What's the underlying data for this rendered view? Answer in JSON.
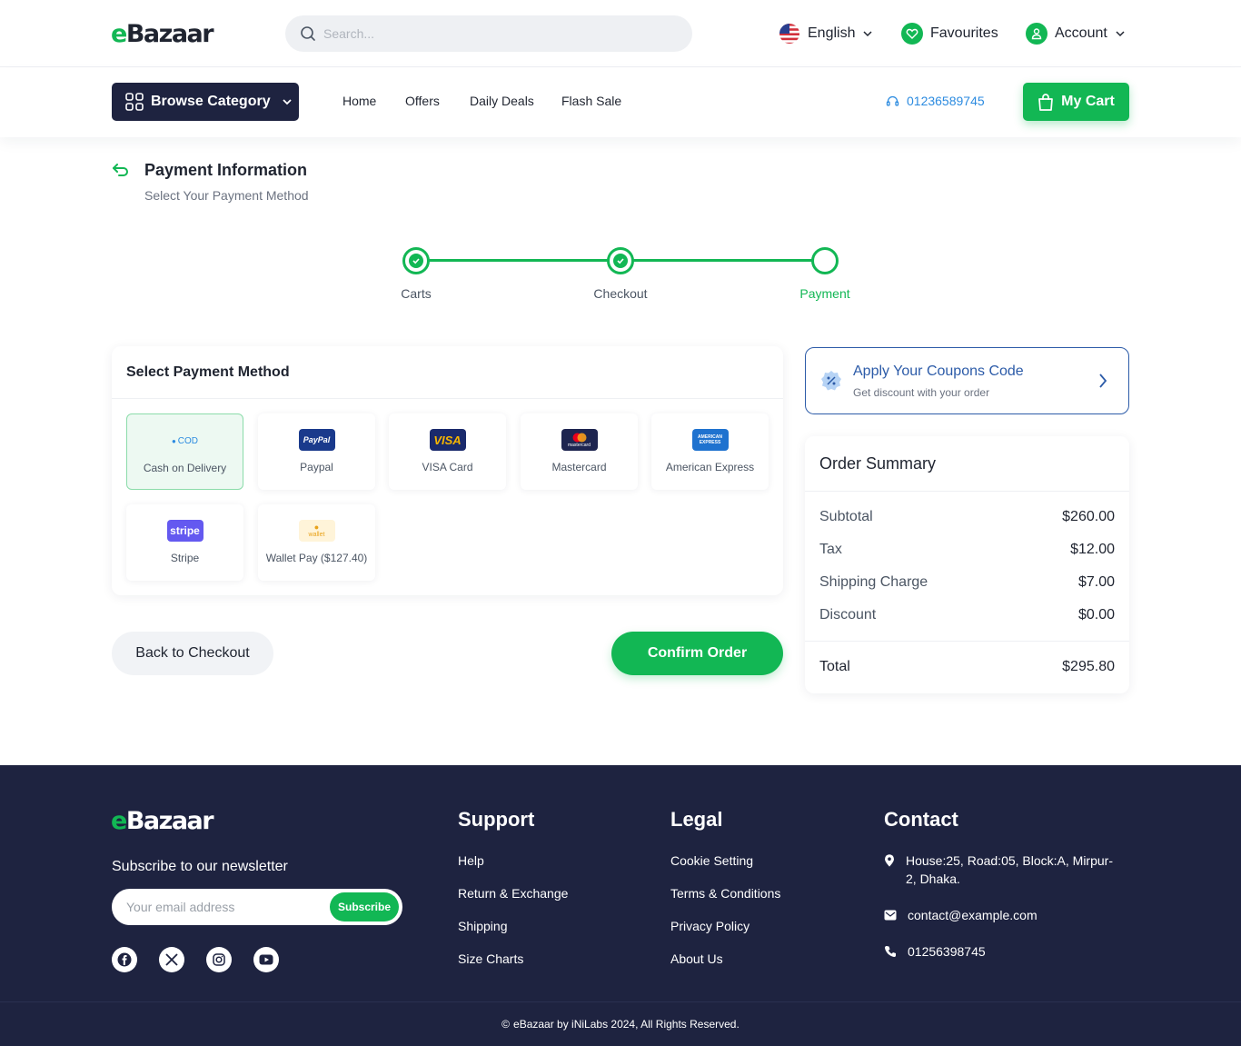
{
  "brand": {
    "logo_e": "e",
    "logo_rest": "Bazaar"
  },
  "header": {
    "search_placeholder": "Search...",
    "language": "English",
    "favourites": "Favourites",
    "account": "Account"
  },
  "nav": {
    "browse": "Browse Category",
    "links": [
      "Home",
      "Offers",
      "Daily Deals",
      "Flash Sale"
    ],
    "phone": "01236589745",
    "cart": "My Cart"
  },
  "page": {
    "title": "Payment Information",
    "subtitle": "Select Your Payment Method"
  },
  "stepper": {
    "steps": [
      {
        "label": "Carts",
        "state": "done"
      },
      {
        "label": "Checkout",
        "state": "done"
      },
      {
        "label": "Payment",
        "state": "current"
      }
    ]
  },
  "payment": {
    "title": "Select Payment Method",
    "methods": [
      {
        "name": "Cash on Delivery",
        "logo": "COD",
        "color": "#edf9f2",
        "selected": true
      },
      {
        "name": "Paypal",
        "logo": "PayPal",
        "color": "#1a3a8c"
      },
      {
        "name": "VISA Card",
        "logo": "VISA",
        "color": "#1a2a6c"
      },
      {
        "name": "Mastercard",
        "logo": "mastercard",
        "color": "#1e2550"
      },
      {
        "name": "American Express",
        "logo": "AMERICAN EXPRESS",
        "color": "#1f72cf"
      },
      {
        "name": "Stripe",
        "logo": "stripe",
        "color": "#6459f0"
      },
      {
        "name": "Wallet Pay ($127.40)",
        "logo": "wallet",
        "color": "#fff4d9"
      }
    ],
    "back_label": "Back to Checkout",
    "confirm_label": "Confirm Order"
  },
  "coupon": {
    "title": "Apply Your Coupons Code",
    "subtitle": "Get discount with your order"
  },
  "summary": {
    "title": "Order Summary",
    "rows": [
      {
        "label": "Subtotal",
        "value": "$260.00"
      },
      {
        "label": "Tax",
        "value": "$12.00"
      },
      {
        "label": "Shipping Charge",
        "value": "$7.00"
      },
      {
        "label": "Discount",
        "value": "$0.00"
      }
    ],
    "total_label": "Total",
    "total_value": "$295.80"
  },
  "footer": {
    "newsletter_title": "Subscribe to our newsletter",
    "email_placeholder": "Your email address",
    "subscribe": "Subscribe",
    "support_title": "Support",
    "support_links": [
      "Help",
      "Return & Exchange",
      "Shipping",
      "Size Charts"
    ],
    "legal_title": "Legal",
    "legal_links": [
      "Cookie Setting",
      "Terms & Conditions",
      "Privacy Policy",
      "About Us"
    ],
    "contact_title": "Contact",
    "address": "House:25, Road:05, Block:A, Mirpur-2, Dhaka.",
    "email": "contact@example.com",
    "phone": "01256398745",
    "copyright": "eBazaar by iNiLabs 2024, All Rights Reserved."
  },
  "colors": {
    "accent": "#12b754",
    "navy": "#1e2340",
    "link_blue": "#2c8be0"
  }
}
